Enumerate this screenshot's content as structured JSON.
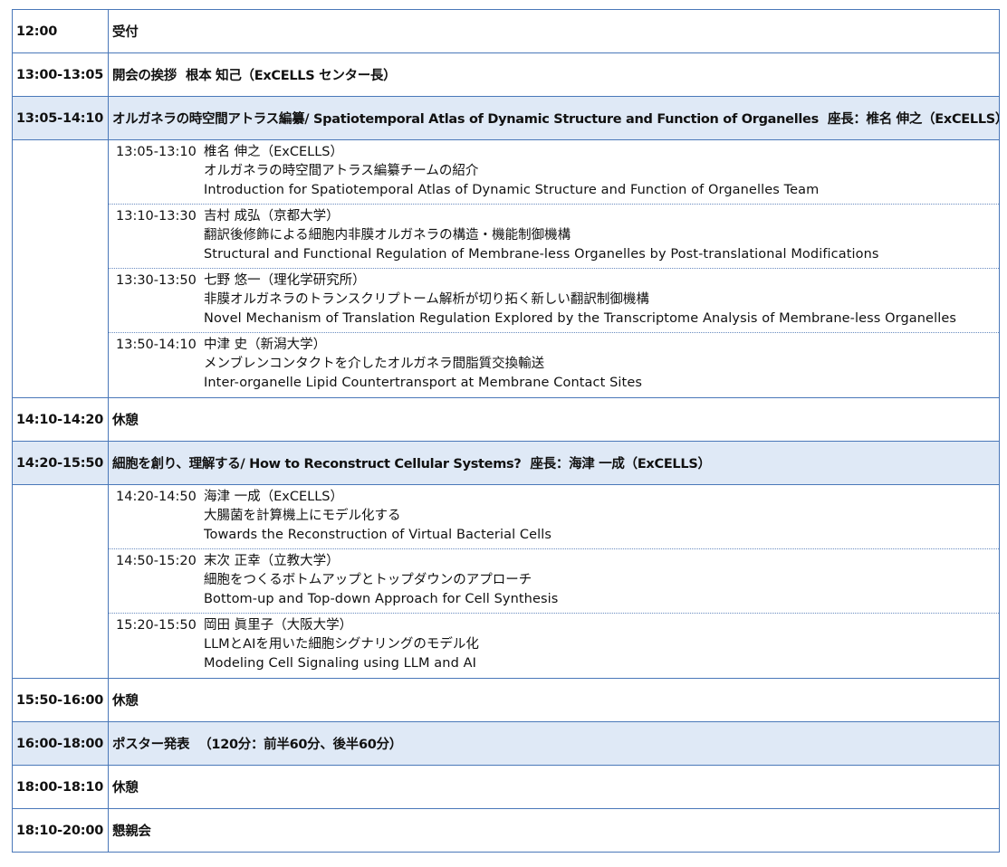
{
  "schedule": [
    {
      "time": "12:00",
      "title": "受付"
    },
    {
      "time": "13:00-13:05",
      "title": "開会の挨拶",
      "speaker": "根本 知己（ExCELLS センター長）"
    },
    {
      "time": "13:05-14:10",
      "title": "オルガネラの時空間アトラス編纂/ Spatiotemporal Atlas of Dynamic Structure and Function of Organelles",
      "chair": "座長：椎名 伸之（ExCELLS）",
      "talks": [
        {
          "time": "13:05-13:10",
          "speaker": "椎名 伸之（ExCELLS）",
          "title_ja": "オルガネラの時空間アトラス編纂チームの紹介",
          "title_en": "Introduction for Spatiotemporal Atlas of Dynamic Structure and Function of Organelles Team"
        },
        {
          "time": "13:10-13:30",
          "speaker": "吉村 成弘（京都大学）",
          "title_ja": "翻訳後修飾による細胞内非膜オルガネラの構造・機能制御機構",
          "title_en": "Structural and Functional Regulation of Membrane-less Organelles by Post-translational Modifications"
        },
        {
          "time": "13:30-13:50",
          "speaker": "七野 悠一（理化学研究所）",
          "title_ja": "非膜オルガネラのトランスクリプトーム解析が切り拓く新しい翻訳制御機構",
          "title_en": "Novel Mechanism of Translation Regulation Explored by the Transcriptome Analysis of Membrane-less Organelles"
        },
        {
          "time": "13:50-14:10",
          "speaker": "中津 史（新潟大学）",
          "title_ja": "メンブレンコンタクトを介したオルガネラ間脂質交換輸送",
          "title_en": "Inter-organelle Lipid Countertransport at Membrane Contact Sites"
        }
      ]
    },
    {
      "time": "14:10-14:20",
      "title": "休憩"
    },
    {
      "time": "14:20-15:50",
      "title": "細胞を創り、理解する/ How to Reconstruct Cellular Systems?",
      "chair": "座長：海津 一成（ExCELLS）",
      "talks": [
        {
          "time": "14:20-14:50",
          "speaker": "海津 一成（ExCELLS）",
          "title_ja": "大腸菌を計算機上にモデル化する",
          "title_en": "Towards the Reconstruction of Virtual Bacterial Cells"
        },
        {
          "time": "14:50-15:20",
          "speaker": "末次 正幸（立教大学）",
          "title_ja": "細胞をつくるボトムアップとトップダウンのアプローチ",
          "title_en": "Bottom-up and Top-down Approach for Cell Synthesis"
        },
        {
          "time": "15:20-15:50",
          "speaker": "岡田 眞里子（大阪大学）",
          "title_ja": "LLMとAIを用いた細胞シグナリングのモデル化",
          "title_en": "Modeling Cell Signaling using LLM and AI"
        }
      ]
    },
    {
      "time": "15:50-16:00",
      "title": "休憩"
    },
    {
      "time": "16:00-18:00",
      "title": "ポスター発表",
      "note": "（120分：前半60分、後半60分）"
    },
    {
      "time": "18:00-18:10",
      "title": "休憩"
    },
    {
      "time": "18:10-20:00",
      "title": "懇親会"
    }
  ]
}
